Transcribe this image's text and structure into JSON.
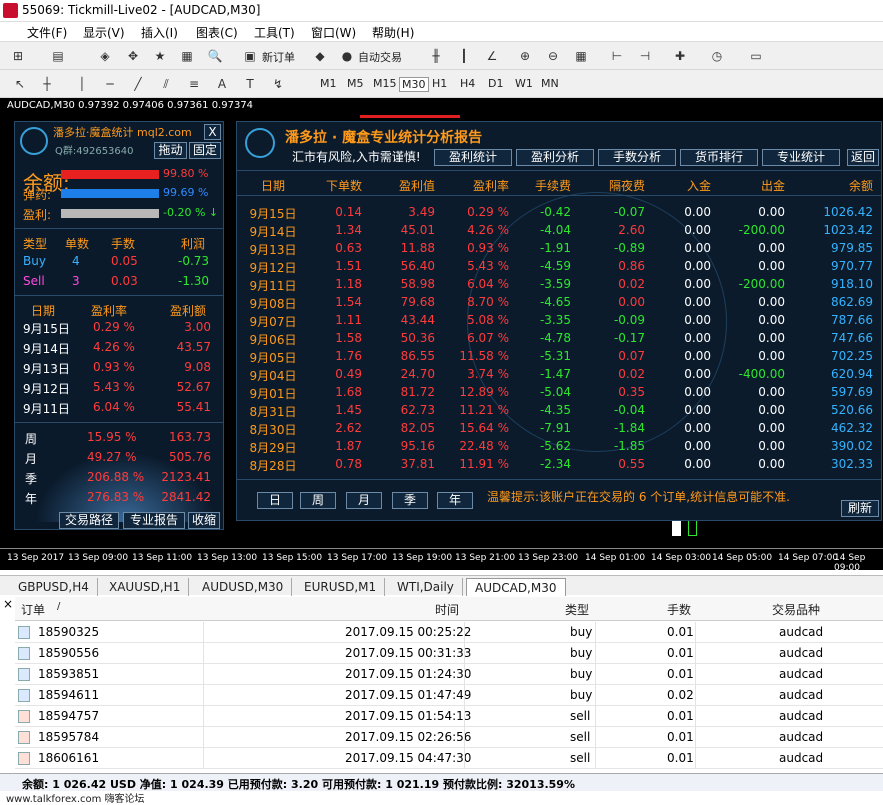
{
  "window": {
    "title": "55069: Tickmill-Live02 - [AUDCAD,M30]"
  },
  "menu": [
    "文件(F)",
    "显示(V)",
    "插入(I)",
    "图表(C)",
    "工具(T)",
    "窗口(W)",
    "帮助(H)"
  ],
  "toolbar": {
    "new_order": "新订单",
    "auto_trade": "自动交易"
  },
  "timeframes": [
    "M1",
    "M5",
    "M15",
    "M30",
    "H1",
    "H4",
    "D1",
    "W1",
    "MN"
  ],
  "chart": {
    "symbol_line": "AUDCAD,M30  0.97392 0.97406 0.97361 0.97374",
    "x_labels": [
      "13 Sep 2017",
      "13 Sep 09:00",
      "13 Sep 11:00",
      "13 Sep 13:00",
      "13 Sep 15:00",
      "13 Sep 17:00",
      "13 Sep 19:00",
      "13 Sep 21:00",
      "13 Sep 23:00",
      "14 Sep 01:00",
      "14 Sep 03:00",
      "14 Sep 05:00",
      "14 Sep 07:00",
      "14 Sep 09:00"
    ]
  },
  "left_panel": {
    "title": "潘多拉·魔盒统计 mql2.com",
    "close": "X",
    "qgroup": "Q群:492653640",
    "btn_drag": "拖动",
    "btn_fix": "固定",
    "balance_label": "余额:",
    "balance_pct": "99.80 %",
    "ammo_label": "弹药:",
    "ammo_pct": "99.69 %",
    "profit_label": "盈利:",
    "profit_pct": "-0.20 % ↓",
    "table_head": [
      "类型",
      "单数",
      "手数",
      "利润"
    ],
    "buy": [
      "Buy",
      "4",
      "0.05",
      "-0.73"
    ],
    "sell": [
      "Sell",
      "3",
      "0.03",
      "-1.30"
    ],
    "daily_head": [
      "日期",
      "盈利率",
      "盈利额"
    ],
    "daily": [
      {
        "d": "9月15日",
        "r": "0.29 %",
        "a": "3.00"
      },
      {
        "d": "9月14日",
        "r": "4.26 %",
        "a": "43.57"
      },
      {
        "d": "9月13日",
        "r": "0.93 %",
        "a": "9.08"
      },
      {
        "d": "9月12日",
        "r": "5.43 %",
        "a": "52.67"
      },
      {
        "d": "9月11日",
        "r": "6.04 %",
        "a": "55.41"
      }
    ],
    "period": [
      {
        "p": "周",
        "r": "15.95 %",
        "a": "163.73"
      },
      {
        "p": "月",
        "r": "49.27 %",
        "a": "505.76"
      },
      {
        "p": "季",
        "r": "206.88 %",
        "a": "2123.41"
      },
      {
        "p": "年",
        "r": "276.83 %",
        "a": "2841.42"
      }
    ],
    "btn_path": "交易路径",
    "btn_report": "专业报告",
    "btn_collapse": "收缩"
  },
  "right_panel": {
    "title": "潘多拉 · 魔盒专业统计分析报告",
    "subtitle": "汇市有风险,入市需谨慎!",
    "nav": [
      "盈利统计",
      "盈利分析",
      "手数分析",
      "货币排行",
      "专业统计",
      "返回"
    ],
    "head": [
      "日期",
      "下单数",
      "盈利值",
      "盈利率",
      "手续费",
      "隔夜费",
      "入金",
      "出金",
      "余额"
    ],
    "rows": [
      [
        "9月15日",
        "0.14",
        "3.49",
        "0.29 %",
        "-0.42",
        "-0.07",
        "0.00",
        "0.00",
        "1026.42"
      ],
      [
        "9月14日",
        "1.34",
        "45.01",
        "4.26 %",
        "-4.04",
        "2.60",
        "0.00",
        "-200.00",
        "1023.42"
      ],
      [
        "9月13日",
        "0.63",
        "11.88",
        "0.93 %",
        "-1.91",
        "-0.89",
        "0.00",
        "0.00",
        "979.85"
      ],
      [
        "9月12日",
        "1.51",
        "56.40",
        "5.43 %",
        "-4.59",
        "0.86",
        "0.00",
        "0.00",
        "970.77"
      ],
      [
        "9月11日",
        "1.18",
        "58.98",
        "6.04 %",
        "-3.59",
        "0.02",
        "0.00",
        "-200.00",
        "918.10"
      ],
      [
        "9月08日",
        "1.54",
        "79.68",
        "8.70 %",
        "-4.65",
        "0.00",
        "0.00",
        "0.00",
        "862.69"
      ],
      [
        "9月07日",
        "1.11",
        "43.44",
        "5.08 %",
        "-3.35",
        "-0.09",
        "0.00",
        "0.00",
        "787.66"
      ],
      [
        "9月06日",
        "1.58",
        "50.36",
        "6.07 %",
        "-4.78",
        "-0.17",
        "0.00",
        "0.00",
        "747.66"
      ],
      [
        "9月05日",
        "1.76",
        "86.55",
        "11.58 %",
        "-5.31",
        "0.07",
        "0.00",
        "0.00",
        "702.25"
      ],
      [
        "9月04日",
        "0.49",
        "24.70",
        "3.74 %",
        "-1.47",
        "0.02",
        "0.00",
        "-400.00",
        "620.94"
      ],
      [
        "9月01日",
        "1.68",
        "81.72",
        "12.89 %",
        "-5.04",
        "0.35",
        "0.00",
        "0.00",
        "597.69"
      ],
      [
        "8月31日",
        "1.45",
        "62.73",
        "11.21 %",
        "-4.35",
        "-0.04",
        "0.00",
        "0.00",
        "520.66"
      ],
      [
        "8月30日",
        "2.62",
        "82.05",
        "15.64 %",
        "-7.91",
        "-1.84",
        "0.00",
        "0.00",
        "462.32"
      ],
      [
        "8月29日",
        "1.87",
        "95.16",
        "22.48 %",
        "-5.62",
        "-1.85",
        "0.00",
        "0.00",
        "390.02"
      ],
      [
        "8月28日",
        "0.78",
        "37.81",
        "11.91 %",
        "-2.34",
        "0.55",
        "0.00",
        "0.00",
        "302.33"
      ]
    ],
    "period_btns": [
      "日",
      "周",
      "月",
      "季",
      "年"
    ],
    "tip": "温馨提示:该账户正在交易的 6 个订单,统计信息可能不准.",
    "refresh": "刷新"
  },
  "chart_tabs": [
    "GBPUSD,H4",
    "XAUUSD,H1",
    "AUDUSD,M30",
    "EURUSD,M1",
    "WTI,Daily",
    "AUDCAD,M30"
  ],
  "terminal": {
    "close": "×",
    "head": {
      "order": "订单",
      "sort": "/",
      "time": "时间",
      "type": "类型",
      "lots": "手数",
      "symbol": "交易品种"
    },
    "rows": [
      {
        "id": "18590325",
        "time": "2017.09.15 00:25:22",
        "type": "buy",
        "lots": "0.01",
        "sym": "audcad"
      },
      {
        "id": "18590556",
        "time": "2017.09.15 00:31:33",
        "type": "buy",
        "lots": "0.01",
        "sym": "audcad"
      },
      {
        "id": "18593851",
        "time": "2017.09.15 01:24:30",
        "type": "buy",
        "lots": "0.01",
        "sym": "audcad"
      },
      {
        "id": "18594611",
        "time": "2017.09.15 01:47:49",
        "type": "buy",
        "lots": "0.02",
        "sym": "audcad"
      },
      {
        "id": "18594757",
        "time": "2017.09.15 01:54:13",
        "type": "sell",
        "lots": "0.01",
        "sym": "audcad"
      },
      {
        "id": "18595784",
        "time": "2017.09.15 02:26:56",
        "type": "sell",
        "lots": "0.01",
        "sym": "audcad"
      },
      {
        "id": "18606161",
        "time": "2017.09.15 04:47:30",
        "type": "sell",
        "lots": "0.01",
        "sym": "audcad"
      }
    ],
    "status": "余额: 1 026.42 USD  净值: 1 024.39  已用预付款: 3.20  可用预付款: 1 021.19  预付款比例: 32013.59%"
  },
  "watermark": "www.talkforex.com 嗨客论坛",
  "colors": {
    "red": "#ff3b3b",
    "green": "#2ee62e",
    "blue": "#2f8bff",
    "orange": "#ff9a1a"
  }
}
